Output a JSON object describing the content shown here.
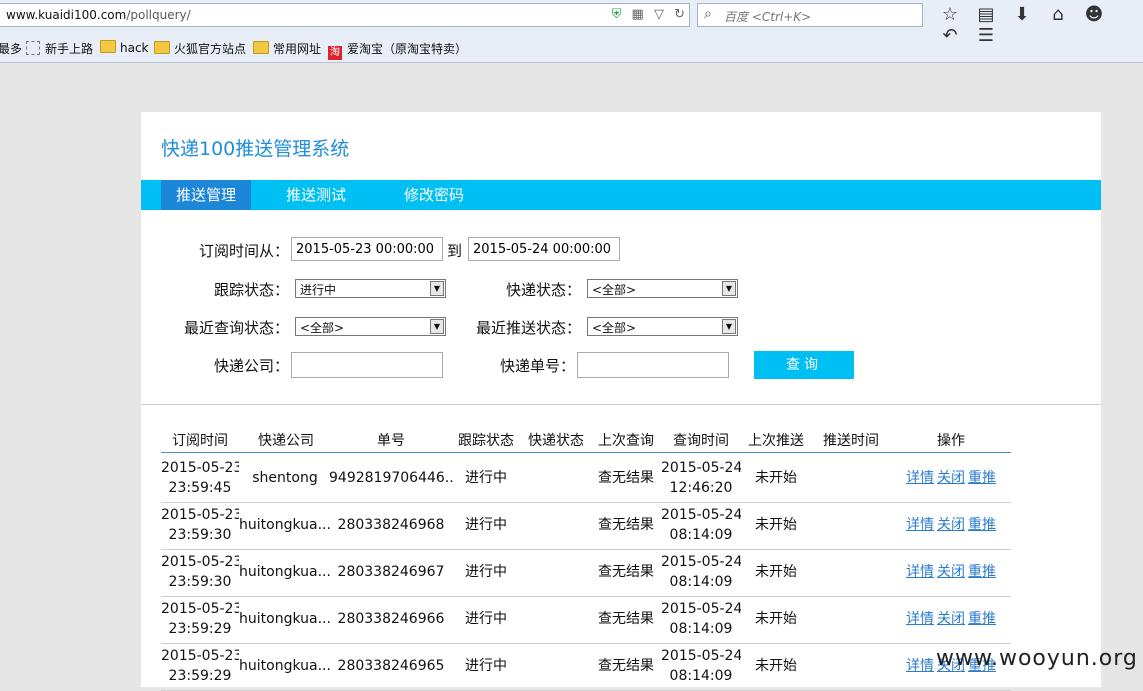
{
  "browser": {
    "url_host": "www.kuaidi100.com",
    "url_path": "/pollquery/",
    "search_placeholder": "百度 <Ctrl+K>",
    "bookmarks": [
      "最多",
      "新手上路",
      "hack",
      "火狐官方站点",
      "常用网址",
      "爱淘宝（原淘宝特卖）"
    ],
    "taobao_glyph": "淘"
  },
  "page": {
    "title": "快递100推送管理系统",
    "nav": [
      "推送管理",
      "推送测试",
      "修改密码"
    ],
    "filters": {
      "time_from_label": "订阅时间从：",
      "time_from": "2015-05-23 00:00:00",
      "to_label": "到",
      "time_to": "2015-05-24 00:00:00",
      "track_label": "跟踪状态：",
      "track_value": "进行中",
      "express_status_label": "快递状态：",
      "express_status_value": "<全部>",
      "query_status_label": "最近查询状态：",
      "query_status_value": "<全部>",
      "push_status_label": "最近推送状态：",
      "push_status_value": "<全部>",
      "company_label": "快递公司：",
      "number_label": "快递单号：",
      "search_button": "查询"
    },
    "table": {
      "headers": [
        "订阅时间",
        "快递公司",
        "单号",
        "跟踪状态",
        "快递状态",
        "上次查询",
        "查询时间",
        "上次推送",
        "推送时间",
        "操作"
      ],
      "rows": [
        {
          "sub_date": "2015-05-23",
          "sub_time": "23:59:45",
          "company": "shentong",
          "number": "9492819706446...",
          "track": "进行中",
          "express": "",
          "last_query": "查无结果",
          "q_date": "2015-05-24",
          "q_time": "12:46:20",
          "last_push": "未开始",
          "push_time": ""
        },
        {
          "sub_date": "2015-05-23",
          "sub_time": "23:59:30",
          "company": "huitongkua...",
          "number": "280338246968",
          "track": "进行中",
          "express": "",
          "last_query": "查无结果",
          "q_date": "2015-05-24",
          "q_time": "08:14:09",
          "last_push": "未开始",
          "push_time": ""
        },
        {
          "sub_date": "2015-05-23",
          "sub_time": "23:59:30",
          "company": "huitongkua...",
          "number": "280338246967",
          "track": "进行中",
          "express": "",
          "last_query": "查无结果",
          "q_date": "2015-05-24",
          "q_time": "08:14:09",
          "last_push": "未开始",
          "push_time": ""
        },
        {
          "sub_date": "2015-05-23",
          "sub_time": "23:59:29",
          "company": "huitongkua...",
          "number": "280338246966",
          "track": "进行中",
          "express": "",
          "last_query": "查无结果",
          "q_date": "2015-05-24",
          "q_time": "08:14:09",
          "last_push": "未开始",
          "push_time": ""
        },
        {
          "sub_date": "2015-05-23",
          "sub_time": "23:59:29",
          "company": "huitongkua...",
          "number": "280338246965",
          "track": "进行中",
          "express": "",
          "last_query": "查无结果",
          "q_date": "2015-05-24",
          "q_time": "08:14:09",
          "last_push": "未开始",
          "push_time": ""
        }
      ],
      "actions": [
        "详情",
        "关闭",
        "重推"
      ]
    }
  },
  "watermark": "www.wooyun.org",
  "colors": {
    "accent": "#00bff3",
    "nav_active": "#1b87d6",
    "title": "#1e8fd8",
    "link": "#2b7cd1"
  }
}
